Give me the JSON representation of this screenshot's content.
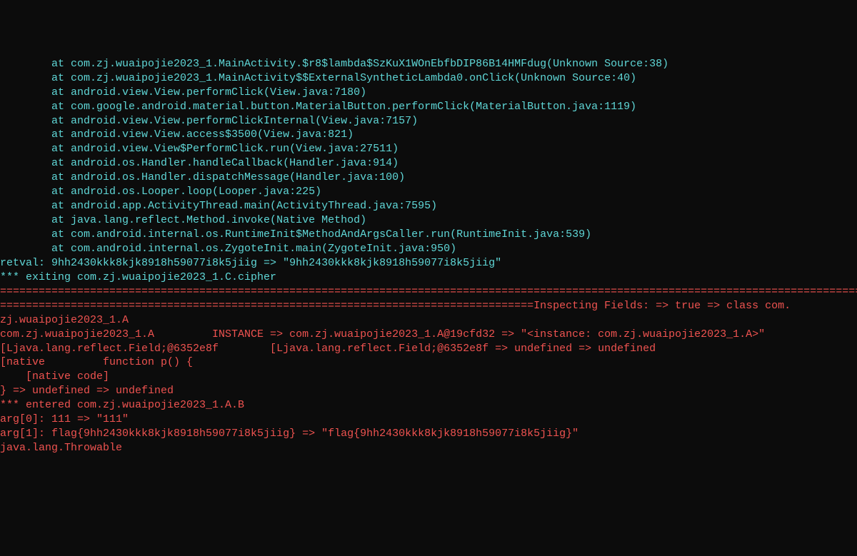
{
  "terminal": {
    "lines": [
      {
        "color": "cyan",
        "text": "        at com.zj.wuaipojie2023_1.MainActivity.$r8$lambda$SzKuX1WOnEbfbDIP86B14HMFdug(Unknown Source:38)"
      },
      {
        "color": "cyan",
        "text": "        at com.zj.wuaipojie2023_1.MainActivity$$ExternalSyntheticLambda0.onClick(Unknown Source:40)"
      },
      {
        "color": "cyan",
        "text": "        at android.view.View.performClick(View.java:7180)"
      },
      {
        "color": "cyan",
        "text": "        at com.google.android.material.button.MaterialButton.performClick(MaterialButton.java:1119)"
      },
      {
        "color": "cyan",
        "text": "        at android.view.View.performClickInternal(View.java:7157)"
      },
      {
        "color": "cyan",
        "text": "        at android.view.View.access$3500(View.java:821)"
      },
      {
        "color": "cyan",
        "text": "        at android.view.View$PerformClick.run(View.java:27511)"
      },
      {
        "color": "cyan",
        "text": "        at android.os.Handler.handleCallback(Handler.java:914)"
      },
      {
        "color": "cyan",
        "text": "        at android.os.Handler.dispatchMessage(Handler.java:100)"
      },
      {
        "color": "cyan",
        "text": "        at android.os.Looper.loop(Looper.java:225)"
      },
      {
        "color": "cyan",
        "text": "        at android.app.ActivityThread.main(ActivityThread.java:7595)"
      },
      {
        "color": "cyan",
        "text": "        at java.lang.reflect.Method.invoke(Native Method)"
      },
      {
        "color": "cyan",
        "text": "        at com.android.internal.os.RuntimeInit$MethodAndArgsCaller.run(RuntimeInit.java:539)"
      },
      {
        "color": "cyan",
        "text": "        at com.android.internal.os.ZygoteInit.main(ZygoteInit.java:950)"
      },
      {
        "color": "cyan",
        "text": ""
      },
      {
        "color": "cyan",
        "text": "retval: 9hh2430kkk8kjk8918h59077i8k5jiig => \"9hh2430kkk8kjk8918h59077i8k5jiig\""
      },
      {
        "color": "cyan",
        "text": "*** exiting com.zj.wuaipojie2023_1.C.cipher"
      },
      {
        "color": "red",
        "text": "================================================================================================================================================"
      },
      {
        "color": "red",
        "text": "===================================================================================Inspecting Fields: => true => class com."
      },
      {
        "color": "red",
        "text": "zj.wuaipojie2023_1.A"
      },
      {
        "color": "red",
        "text": "com.zj.wuaipojie2023_1.A         INSTANCE => com.zj.wuaipojie2023_1.A@19cfd32 => \"<instance: com.zj.wuaipojie2023_1.A>\""
      },
      {
        "color": "red",
        "text": "[Ljava.lang.reflect.Field;@6352e8f        [Ljava.lang.reflect.Field;@6352e8f => undefined => undefined"
      },
      {
        "color": "red",
        "text": "[native         function p() {"
      },
      {
        "color": "red",
        "text": "    [native code]"
      },
      {
        "color": "red",
        "text": "} => undefined => undefined"
      },
      {
        "color": "red",
        "text": ""
      },
      {
        "color": "red",
        "text": "*** entered com.zj.wuaipojie2023_1.A.B"
      },
      {
        "color": "red",
        "text": "arg[0]: 111 => \"111\""
      },
      {
        "color": "red",
        "text": "arg[1]: flag{9hh2430kkk8kjk8918h59077i8k5jiig} => \"flag{9hh2430kkk8kjk8918h59077i8k5jiig}\""
      },
      {
        "color": "red",
        "text": "java.lang.Throwable"
      }
    ]
  }
}
